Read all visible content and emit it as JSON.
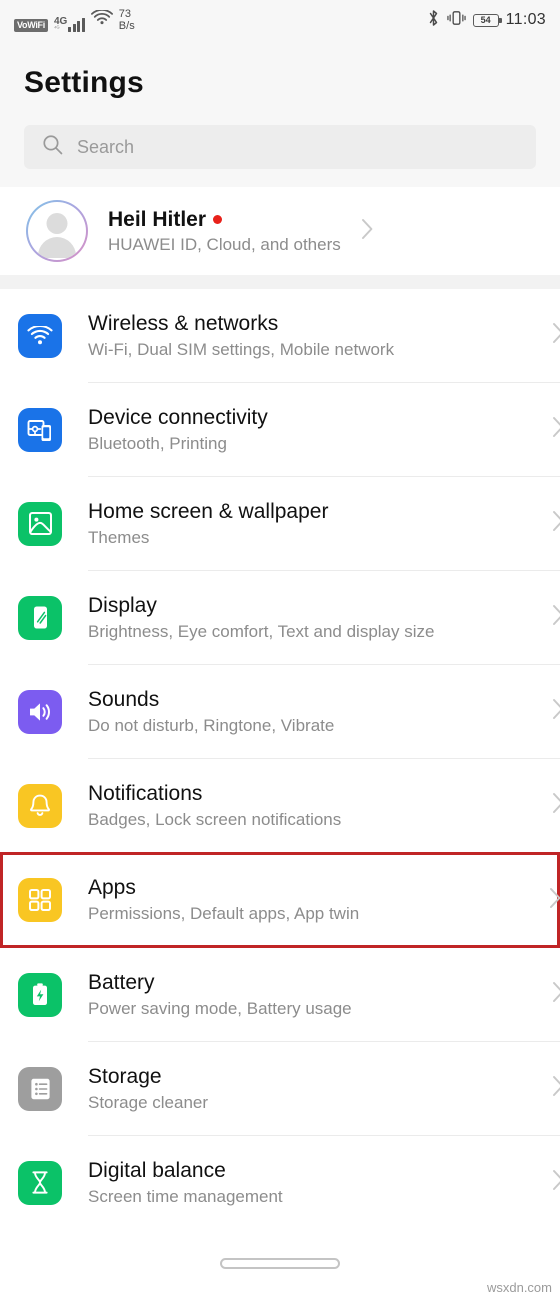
{
  "status_bar": {
    "vowifi_label": "VoWiFi",
    "network_type": "4G",
    "network_sub": "⁴ᴳ",
    "data_speed_value": "73",
    "data_speed_unit": "B/s",
    "bluetooth_icon": "bluetooth-icon",
    "vibrate_icon": "vibrate-icon",
    "battery_percent": "54",
    "time": "11:03"
  },
  "header": {
    "title": "Settings"
  },
  "search": {
    "placeholder": "Search",
    "icon": "search-icon"
  },
  "profile": {
    "name": "Heil Hitler",
    "subtitle": "HUAWEI ID, Cloud, and others",
    "has_notification_dot": true,
    "avatar_icon": "person-avatar-icon"
  },
  "colors": {
    "blue": "#1a73e8",
    "green": "#0bc268",
    "purple": "#7c5cf0",
    "yellow": "#f9c623",
    "gray": "#9e9e9e",
    "highlight_red": "#c02526",
    "notification_red": "#e8211a"
  },
  "settings_items": [
    {
      "title": "Wireless & networks",
      "subtitle": "Wi-Fi, Dual SIM settings, Mobile network",
      "icon": "wifi-icon",
      "color": "#1a73e8",
      "highlighted": false
    },
    {
      "title": "Device connectivity",
      "subtitle": "Bluetooth, Printing",
      "icon": "device-connectivity-icon",
      "color": "#1a73e8",
      "highlighted": false
    },
    {
      "title": "Home screen & wallpaper",
      "subtitle": "Themes",
      "icon": "wallpaper-image-icon",
      "color": "#0bc268",
      "highlighted": false
    },
    {
      "title": "Display",
      "subtitle": "Brightness, Eye comfort, Text and display size",
      "icon": "display-phone-icon",
      "color": "#0bc268",
      "highlighted": false
    },
    {
      "title": "Sounds",
      "subtitle": "Do not disturb, Ringtone, Vibrate",
      "icon": "speaker-volume-icon",
      "color": "#7c5cf0",
      "highlighted": false
    },
    {
      "title": "Notifications",
      "subtitle": "Badges, Lock screen notifications",
      "icon": "bell-icon",
      "color": "#f9c623",
      "highlighted": false
    },
    {
      "title": "Apps",
      "subtitle": "Permissions, Default apps, App twin",
      "icon": "apps-grid-icon",
      "color": "#f9c623",
      "highlighted": true
    },
    {
      "title": "Battery",
      "subtitle": "Power saving mode, Battery usage",
      "icon": "battery-bolt-icon",
      "color": "#0bc268",
      "highlighted": false
    },
    {
      "title": "Storage",
      "subtitle": "Storage cleaner",
      "icon": "storage-list-icon",
      "color": "#9e9e9e",
      "highlighted": false
    },
    {
      "title": "Digital balance",
      "subtitle": "Screen time management",
      "icon": "hourglass-icon",
      "color": "#0bc268",
      "highlighted": false
    }
  ],
  "navigation": {
    "gesture_pill": "home-gesture-pill"
  },
  "watermark": {
    "text": "wsxdn.com"
  }
}
